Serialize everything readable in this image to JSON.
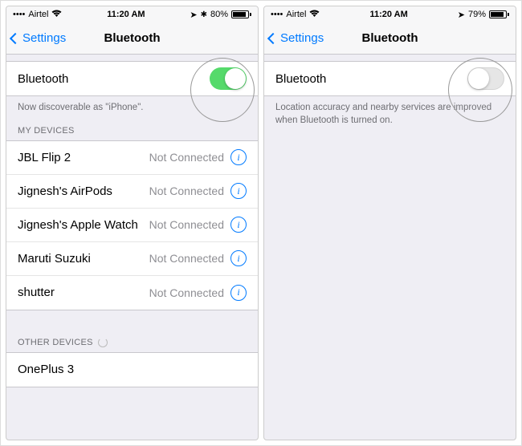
{
  "left": {
    "status": {
      "carrier": "Airtel",
      "time": "11:20 AM",
      "battery_pct": "80%",
      "battery_fill": 80
    },
    "nav": {
      "back": "Settings",
      "title": "Bluetooth"
    },
    "toggle": {
      "label": "Bluetooth"
    },
    "discover_note": "Now discoverable as \"iPhone\".",
    "my_devices_header": "MY DEVICES",
    "devices": [
      {
        "name": "JBL Flip 2",
        "status": "Not Connected"
      },
      {
        "name": "Jignesh's AirPods",
        "status": "Not Connected"
      },
      {
        "name": "Jignesh's Apple Watch",
        "status": "Not Connected"
      },
      {
        "name": "Maruti Suzuki",
        "status": "Not Connected"
      },
      {
        "name": "shutter",
        "status": "Not Connected"
      }
    ],
    "other_devices_header": "OTHER DEVICES",
    "other_devices": [
      {
        "name": "OnePlus 3"
      }
    ]
  },
  "right": {
    "status": {
      "carrier": "Airtel",
      "time": "11:20 AM",
      "battery_pct": "79%",
      "battery_fill": 79
    },
    "nav": {
      "back": "Settings",
      "title": "Bluetooth"
    },
    "toggle": {
      "label": "Bluetooth"
    },
    "off_note": "Location accuracy and nearby services are improved when Bluetooth is turned on."
  }
}
